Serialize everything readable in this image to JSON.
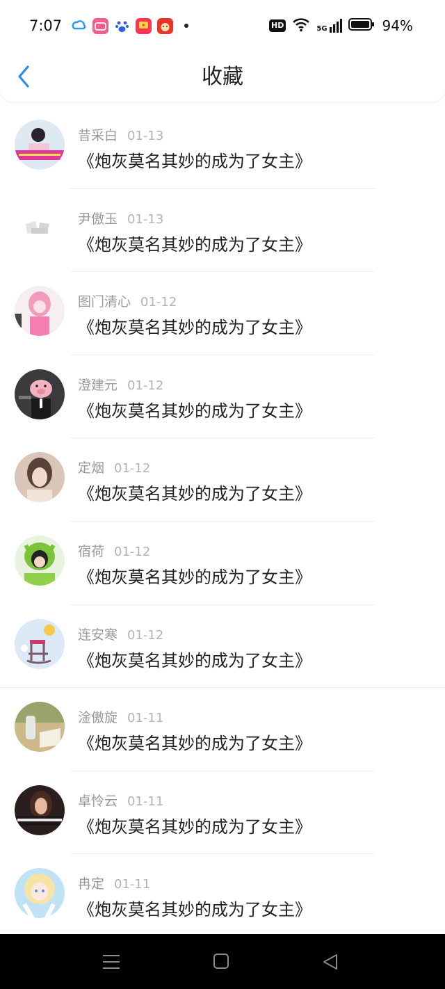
{
  "status_bar": {
    "time": "7:07",
    "network": "5G",
    "battery": "94%",
    "hd": "HD",
    "app_icons": [
      "cloud-app-icon",
      "bilibili-app-icon",
      "baidu-app-icon",
      "video-app-icon",
      "game-app-icon"
    ]
  },
  "header": {
    "title": "收藏",
    "back_icon": "chevron-left-icon",
    "accent": "#2a8cf0"
  },
  "favorites": [
    {
      "user": "昔采白",
      "date": "01-13",
      "title": "《炮灰莫名其妙的成为了女主》"
    },
    {
      "user": "尹傲玉",
      "date": "01-13",
      "title": "《炮灰莫名其妙的成为了女主》"
    },
    {
      "user": "图门清心",
      "date": "01-12",
      "title": "《炮灰莫名其妙的成为了女主》"
    },
    {
      "user": "澄建元",
      "date": "01-12",
      "title": "《炮灰莫名其妙的成为了女主》"
    },
    {
      "user": "定烟",
      "date": "01-12",
      "title": "《炮灰莫名其妙的成为了女主》"
    },
    {
      "user": "宿荷",
      "date": "01-12",
      "title": "《炮灰莫名其妙的成为了女主》"
    },
    {
      "user": "连安寒",
      "date": "01-12",
      "title": "《炮灰莫名其妙的成为了女主》"
    },
    {
      "user": "淦傲旋",
      "date": "01-11",
      "title": "《炮灰莫名其妙的成为了女主》"
    },
    {
      "user": "卓怜云",
      "date": "01-11",
      "title": "《炮灰莫名其妙的成为了女主》"
    },
    {
      "user": "冉定",
      "date": "01-11",
      "title": "《炮灰莫名其妙的成为了女主》"
    }
  ],
  "nav_bar": {
    "icons": [
      "menu-icon",
      "home-icon",
      "back-triangle-icon"
    ]
  }
}
